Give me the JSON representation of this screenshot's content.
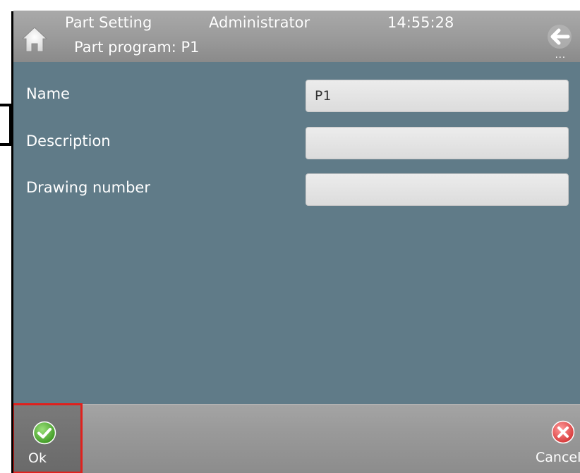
{
  "header": {
    "title": "Part Setting",
    "user": "Administrator",
    "time": "14:55:28",
    "subtitle": "Part program: P1",
    "icons": {
      "home": "home-icon",
      "back": "back-arrow-icon"
    }
  },
  "form": {
    "fields": [
      {
        "label": "Name",
        "value": "P1"
      },
      {
        "label": "Description",
        "value": ""
      },
      {
        "label": "Drawing number",
        "value": ""
      }
    ]
  },
  "footer": {
    "ok_label": "Ok",
    "cancel_label": "Cancel",
    "icons": {
      "ok": "check-icon",
      "cancel": "close-icon"
    }
  },
  "colors": {
    "content_bg": "#607b88",
    "header_bg": "#9a9a9a",
    "highlight": "#e0211d",
    "ok_green": "#5fb83a",
    "cancel_red": "#e04848"
  }
}
